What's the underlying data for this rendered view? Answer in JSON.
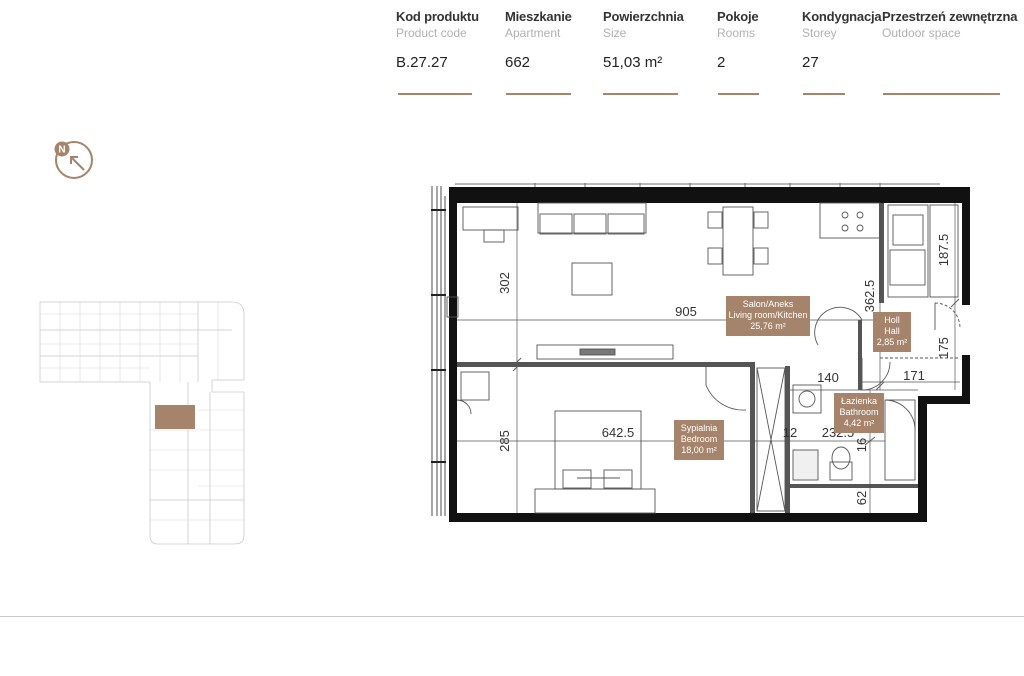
{
  "specs": [
    {
      "label_pl": "Kod produktu",
      "label_en": "Product code",
      "value": "B.27.27"
    },
    {
      "label_pl": "Mieszkanie",
      "label_en": "Apartment",
      "value": "662"
    },
    {
      "label_pl": "Powierzchnia",
      "label_en": "Size",
      "value": "51,03 m²"
    },
    {
      "label_pl": "Pokoje",
      "label_en": "Rooms",
      "value": "2"
    },
    {
      "label_pl": "Kondygnacja",
      "label_en": "Storey",
      "value": "27"
    },
    {
      "label_pl": "Przestrzeń zewnętrzna",
      "label_en": "Outdoor space",
      "value": ""
    }
  ],
  "compass": {
    "letter": "N",
    "icon": "north-arrow-icon"
  },
  "rooms": {
    "living": {
      "line1": "Salon/Aneks",
      "line2": "Living room/Kitchen",
      "area": "25,76 m²"
    },
    "hall": {
      "line1": "Holl",
      "line2": "Hall",
      "area": "2,85 m²"
    },
    "bedroom": {
      "line1": "Sypialnia",
      "line2": "Bedroom",
      "area": "18,00 m²"
    },
    "bathroom": {
      "line1": "Łazienka",
      "line2": "Bathroom",
      "area": "4,42 m²"
    }
  },
  "dimensions": {
    "d302": "302",
    "d905": "905",
    "d3625": "362.5",
    "d1875": "187.5",
    "d175": "175",
    "d140": "140",
    "d171": "171",
    "d285": "285",
    "d6425": "642.5",
    "d12": "12",
    "d2325": "232.5",
    "d16": "16",
    "d62": "62"
  },
  "colors": {
    "accent": "#a5846b",
    "wall": "#111111"
  }
}
